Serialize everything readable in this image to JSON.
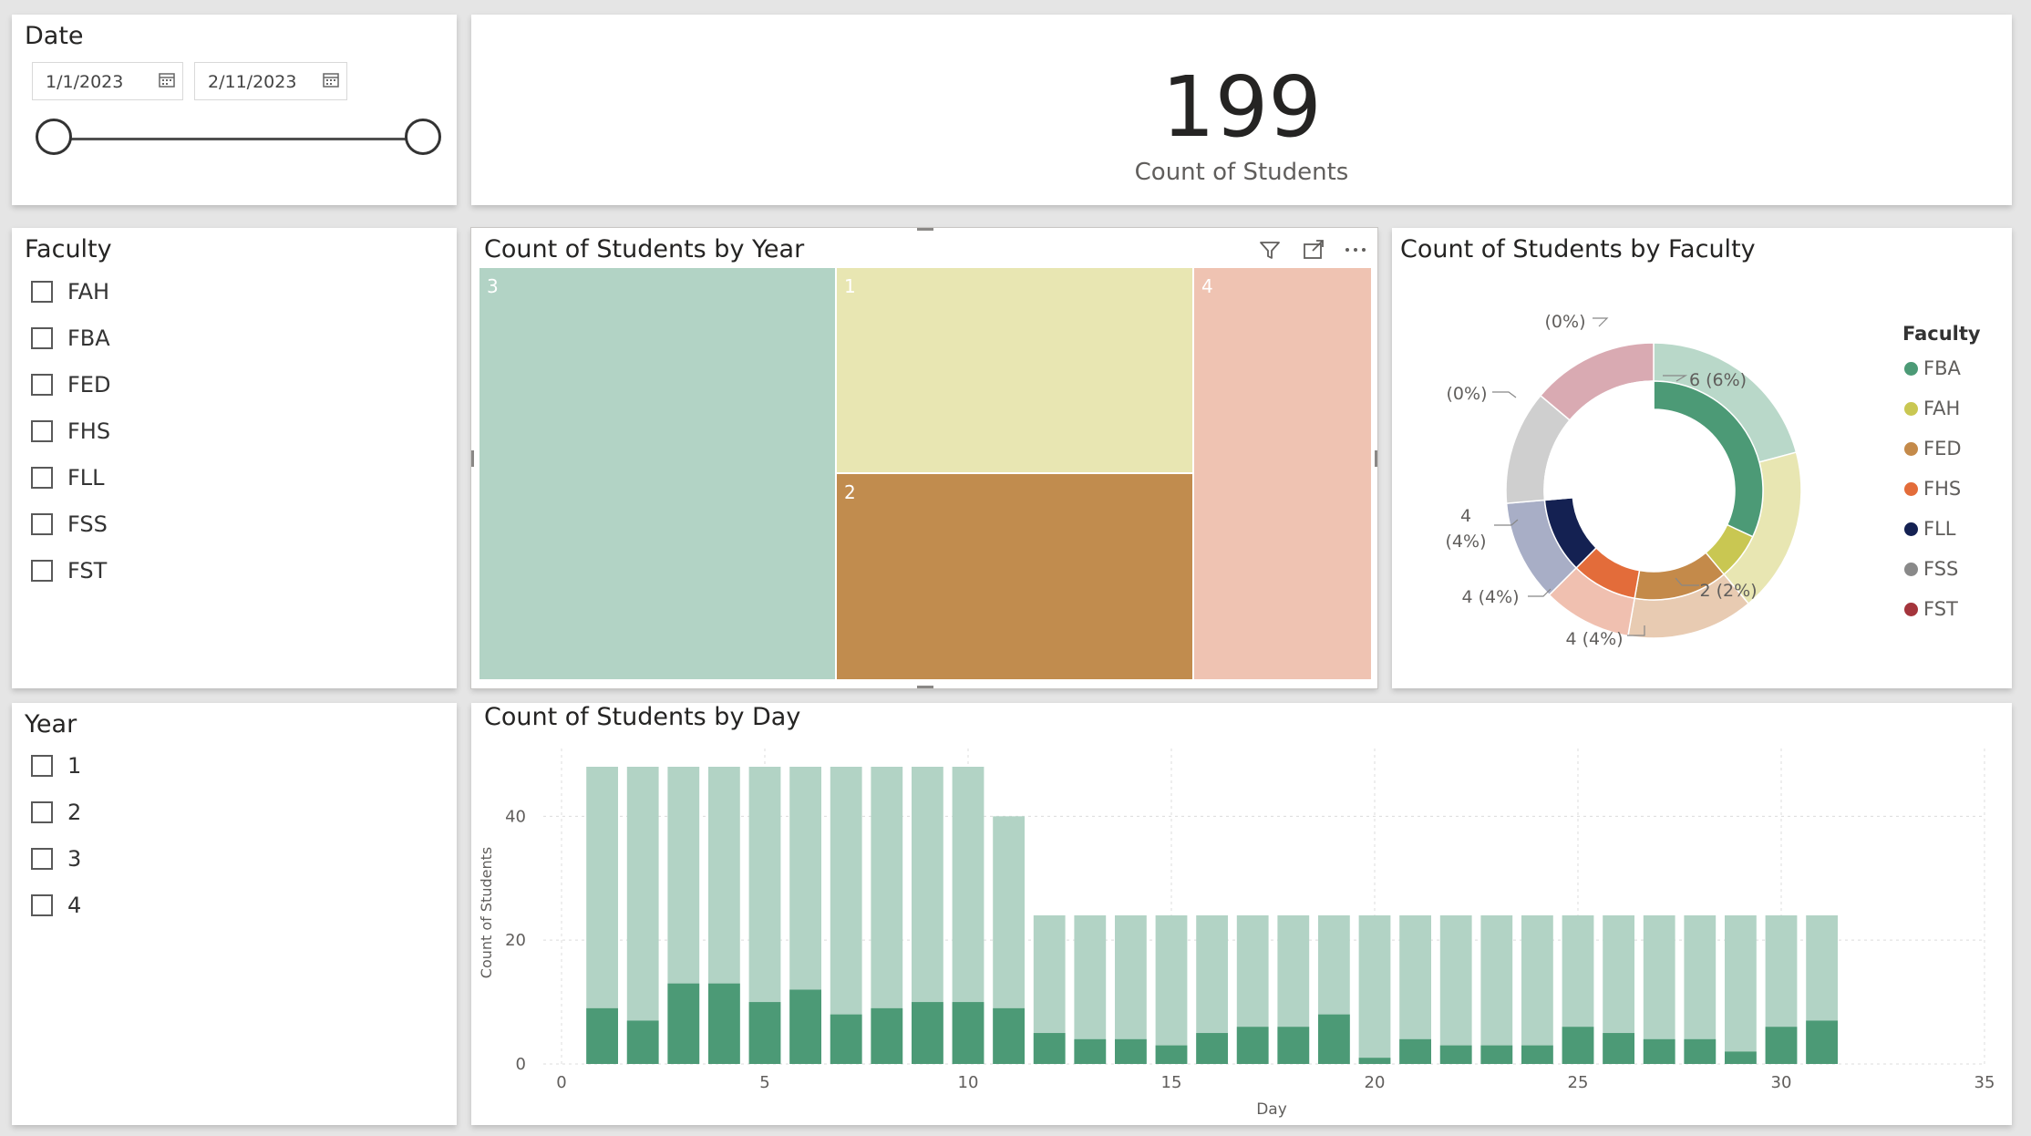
{
  "date_slicer": {
    "title": "Date",
    "start": "1/1/2023",
    "end": "2/11/2023"
  },
  "faculty_slicer": {
    "title": "Faculty",
    "items": [
      "FAH",
      "FBA",
      "FED",
      "FHS",
      "FLL",
      "FSS",
      "FST"
    ]
  },
  "year_slicer": {
    "title": "Year",
    "items": [
      "1",
      "2",
      "3",
      "4"
    ]
  },
  "kpi": {
    "value": "199",
    "label": "Count of Students"
  },
  "treemap": {
    "title": "Count of Students by Year",
    "tiles": [
      {
        "label": "3",
        "color": "#b2d3c5"
      },
      {
        "label": "1",
        "color": "#e8e6b2"
      },
      {
        "label": "2",
        "color": "#c18c4e"
      },
      {
        "label": "4",
        "color": "#efc3b2"
      }
    ]
  },
  "donut": {
    "title": "Count of Students by Faculty",
    "legend_title": "Faculty",
    "legend": [
      {
        "label": "FBA",
        "color": "#4c9a76"
      },
      {
        "label": "FAH",
        "color": "#c9c752"
      },
      {
        "label": "FED",
        "color": "#c48a4a"
      },
      {
        "label": "FHS",
        "color": "#e36c3a"
      },
      {
        "label": "FLL",
        "color": "#142152"
      },
      {
        "label": "FSS",
        "color": "#898989"
      },
      {
        "label": "FST",
        "color": "#a4353c"
      }
    ],
    "labels": [
      "(0%)",
      "6 (6%)",
      "(0%)",
      "4",
      "(4%)",
      "4 (4%)",
      "4 (4%)",
      "2 (2%)"
    ]
  },
  "chart_data": {
    "type": "bar",
    "title": "Count of Students by Day",
    "xlabel": "Day",
    "ylabel": "Count of Students",
    "xlim": [
      0,
      35
    ],
    "ylim": [
      0,
      48
    ],
    "x_ticks": [
      0,
      5,
      10,
      15,
      20,
      25,
      30,
      35
    ],
    "y_ticks": [
      0,
      20,
      40
    ],
    "grid": true,
    "series": [
      {
        "color": "#b2d3c5",
        "values": [
          48,
          48,
          48,
          48,
          48,
          48,
          48,
          48,
          48,
          48,
          40,
          24,
          24,
          24,
          24,
          24,
          24,
          24,
          24,
          24,
          24,
          24,
          24,
          24,
          24,
          24,
          24,
          24,
          24,
          24,
          24
        ]
      },
      {
        "color": "#4c9a76",
        "values": [
          9,
          7,
          13,
          13,
          10,
          12,
          8,
          9,
          10,
          10,
          9,
          5,
          4,
          4,
          3,
          5,
          6,
          6,
          8,
          1,
          4,
          3,
          3,
          3,
          6,
          5,
          4,
          4,
          2,
          6,
          7
        ]
      }
    ],
    "x": [
      1,
      2,
      3,
      4,
      5,
      6,
      7,
      8,
      9,
      10,
      11,
      12,
      13,
      14,
      15,
      16,
      17,
      18,
      19,
      20,
      21,
      22,
      23,
      24,
      25,
      26,
      27,
      28,
      29,
      30,
      31
    ]
  }
}
